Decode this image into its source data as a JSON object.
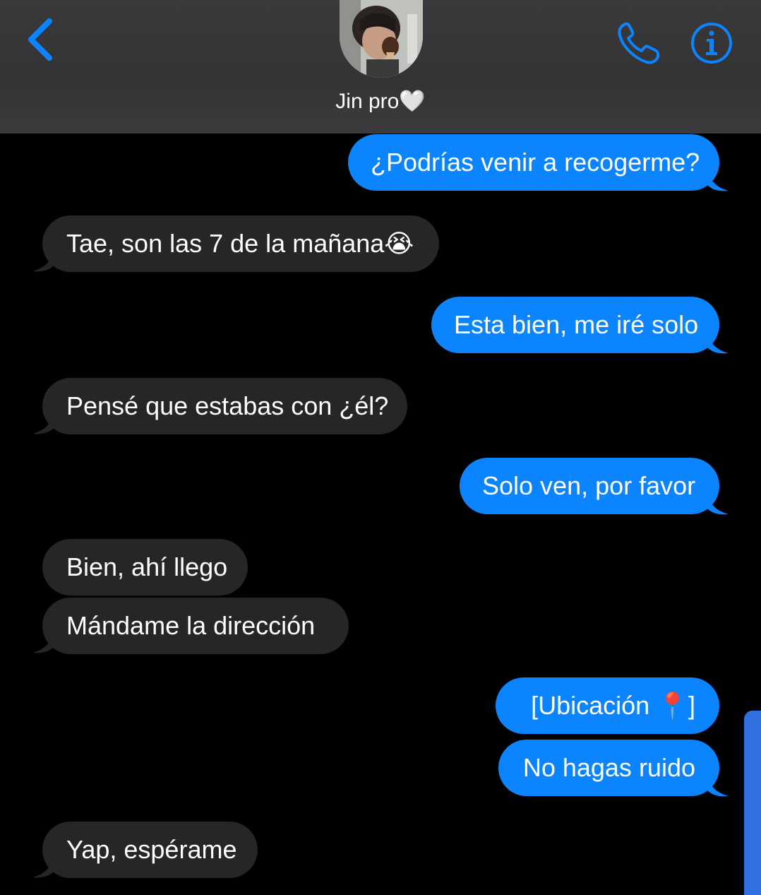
{
  "header": {
    "contact_name": "Jin pro🤍",
    "accent_color": "#0b84fe",
    "icons": [
      "chevron-left-icon",
      "phone-icon",
      "info-icon"
    ]
  },
  "messages": [
    {
      "direction": "outgoing",
      "text": "¿Podrías venir a recogerme?"
    },
    {
      "direction": "incoming",
      "text": "Tae, son las 7 de la mañana😭"
    },
    {
      "direction": "outgoing",
      "text": "Esta bien, me iré solo"
    },
    {
      "direction": "incoming",
      "text": "Pensé que estabas con ¿él?"
    },
    {
      "direction": "outgoing",
      "text": "Solo ven, por favor"
    },
    {
      "direction": "incoming",
      "text": "Bien, ahí llego"
    },
    {
      "direction": "incoming",
      "text": "Mándame la dirección"
    },
    {
      "direction": "outgoing",
      "text": "[Ubicación 📍]"
    },
    {
      "direction": "outgoing",
      "text": "No hagas ruido"
    },
    {
      "direction": "incoming",
      "text": "Yap, espérame"
    }
  ],
  "colors": {
    "outgoing_bubble": "#0b84fe",
    "incoming_bubble": "#262628",
    "background": "#000000"
  }
}
